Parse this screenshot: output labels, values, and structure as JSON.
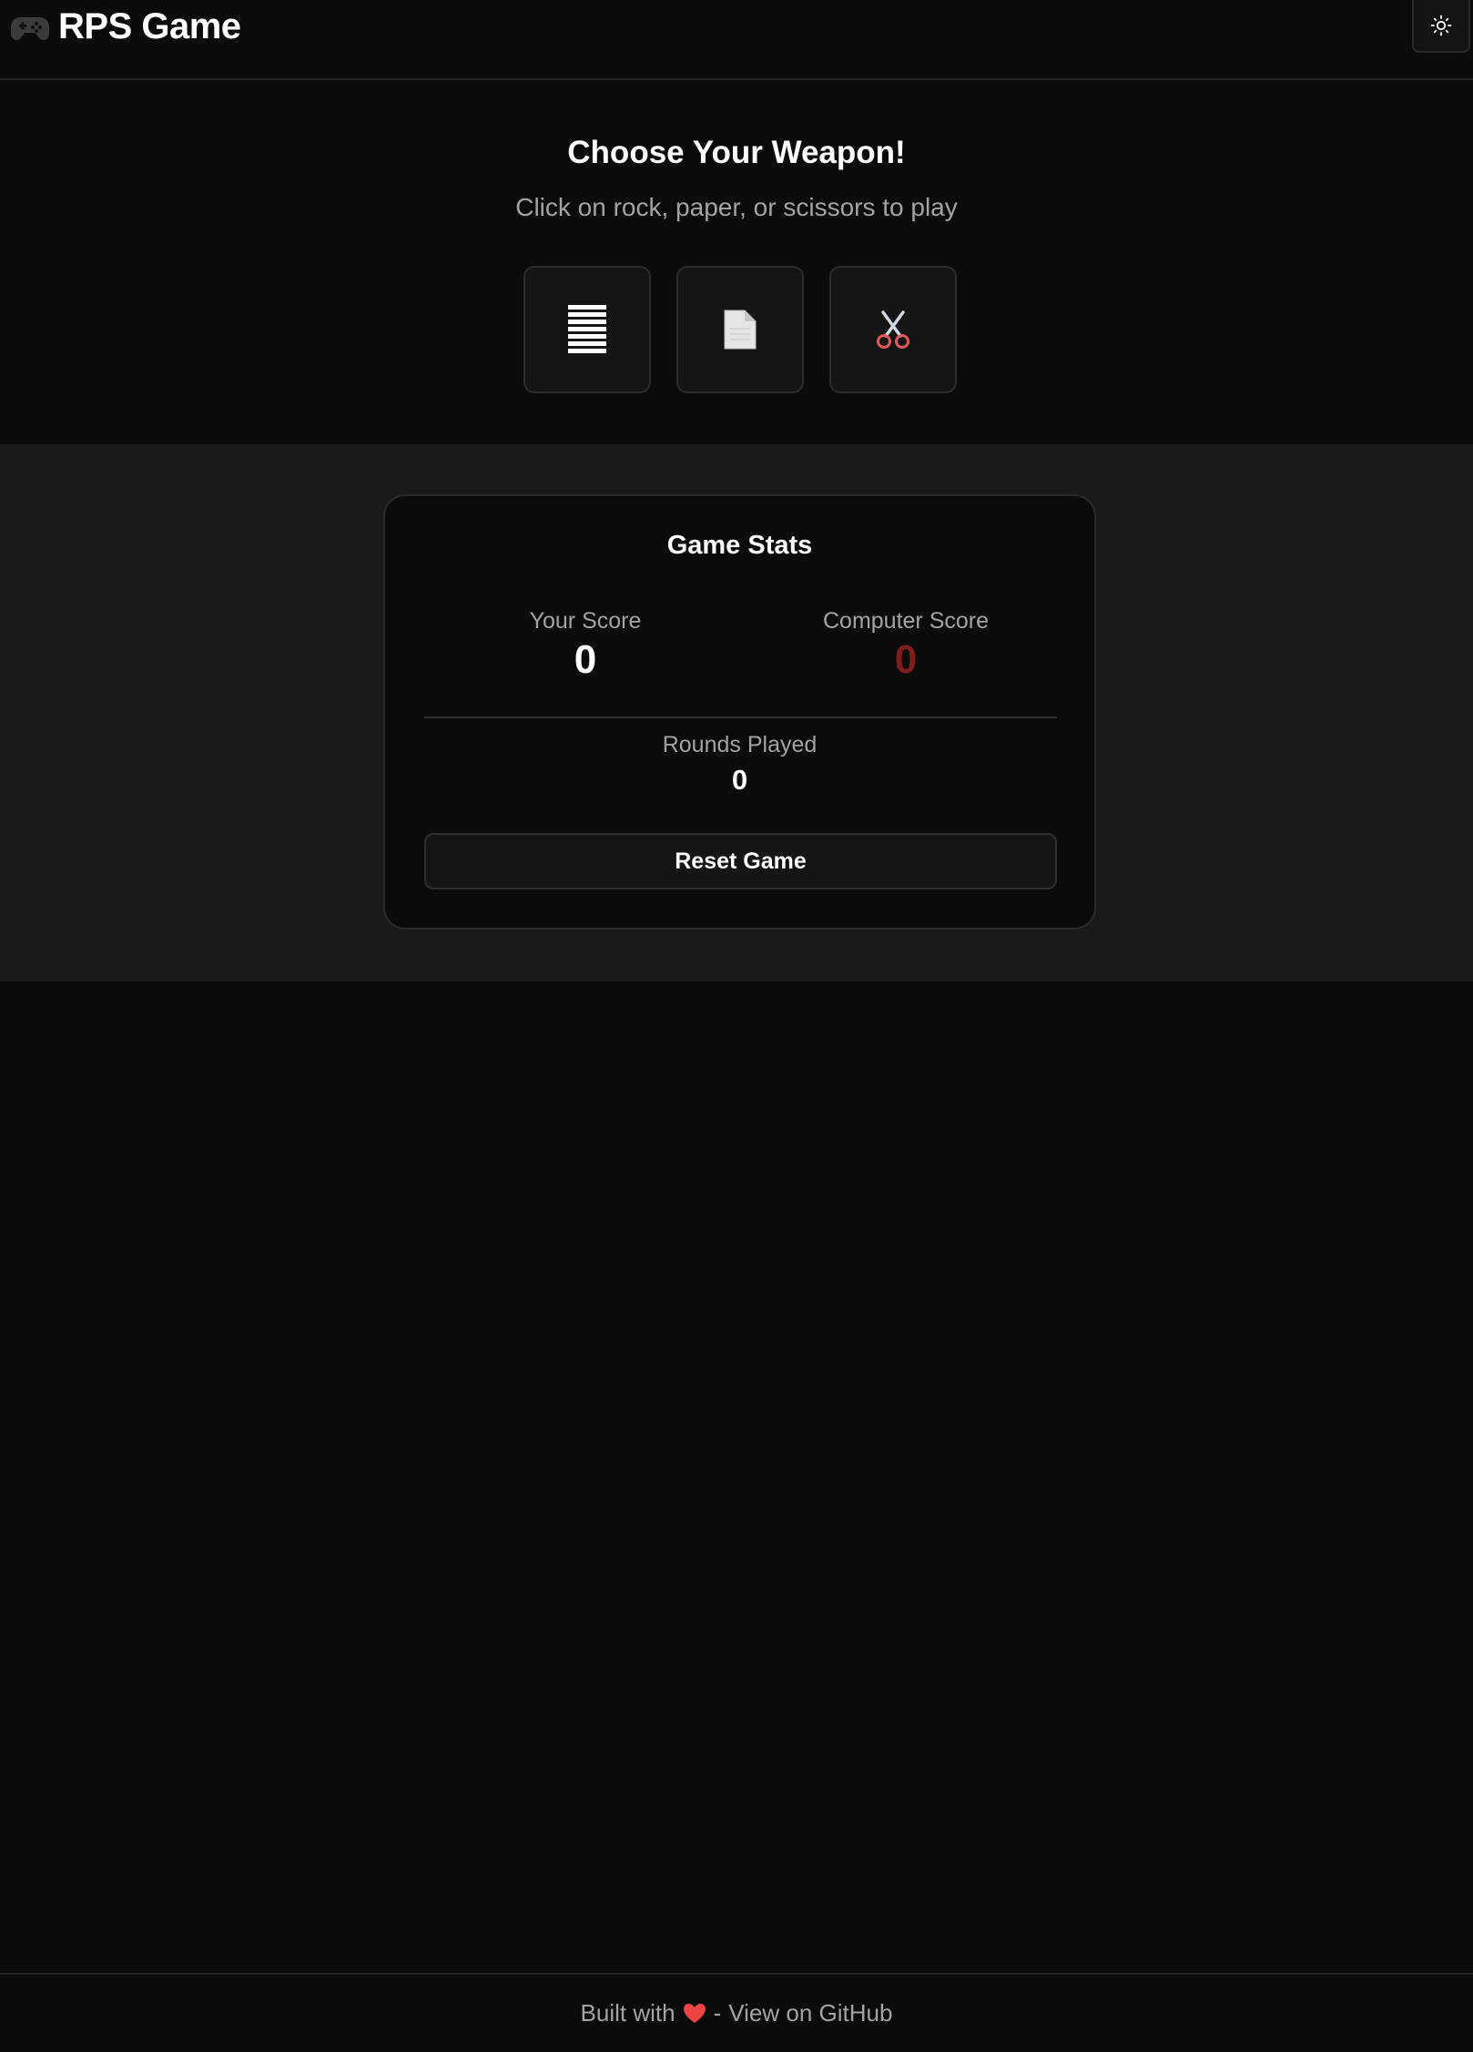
{
  "header": {
    "title": "RPS Game",
    "brand_icon": "gamepad-icon",
    "theme_toggle_icon": "sun-icon"
  },
  "hero": {
    "title": "Choose Your Weapon!",
    "subtitle": "Click on rock, paper, or scissors to play",
    "choices": [
      {
        "name": "rock",
        "icon": "rock-icon"
      },
      {
        "name": "paper",
        "icon": "paper-icon"
      },
      {
        "name": "scissors",
        "icon": "scissors-icon"
      }
    ]
  },
  "stats": {
    "title": "Game Stats",
    "your_score_label": "Your Score",
    "your_score": "0",
    "computer_score_label": "Computer Score",
    "computer_score": "0",
    "rounds_label": "Rounds Played",
    "rounds": "0",
    "reset_label": "Reset Game"
  },
  "footer": {
    "prefix": "Built with",
    "separator": "-",
    "link_text": "View on GitHub",
    "heart_icon": "heart-icon"
  },
  "colors": {
    "background": "#0b0b0b",
    "band": "#1a1a1a",
    "muted_text": "#a3a3a3",
    "computer_score": "#7f1d1d",
    "heart": "#ef4444"
  }
}
